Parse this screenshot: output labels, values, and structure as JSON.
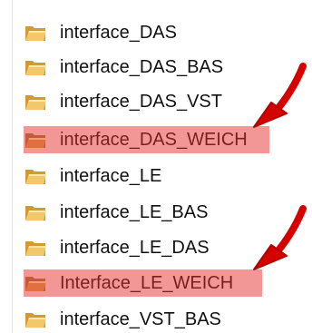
{
  "colors": {
    "highlight": "#ef7c7c",
    "arrow": "#e00000",
    "folder": "#e7b34f",
    "folder_highlight": "#de6e43"
  },
  "folders": [
    {
      "label": "interface_DAS",
      "icon": "folder-icon"
    },
    {
      "label": "interface_DAS_BAS",
      "icon": "folder-icon"
    },
    {
      "label": "interface_DAS_VST",
      "icon": "folder-icon"
    },
    {
      "label": "interface_DAS_WEICH",
      "icon": "folder-icon",
      "highlighted": true
    },
    {
      "label": "interface_LE",
      "icon": "folder-icon"
    },
    {
      "label": "interface_LE_BAS",
      "icon": "folder-icon"
    },
    {
      "label": "interface_LE_DAS",
      "icon": "folder-icon"
    },
    {
      "label": "Interface_LE_WEICH",
      "icon": "folder-icon",
      "highlighted": true
    },
    {
      "label": "interface_VST_BAS",
      "icon": "folder-icon"
    }
  ],
  "annotations": {
    "arrow_icon": "red-arrow-icon"
  }
}
